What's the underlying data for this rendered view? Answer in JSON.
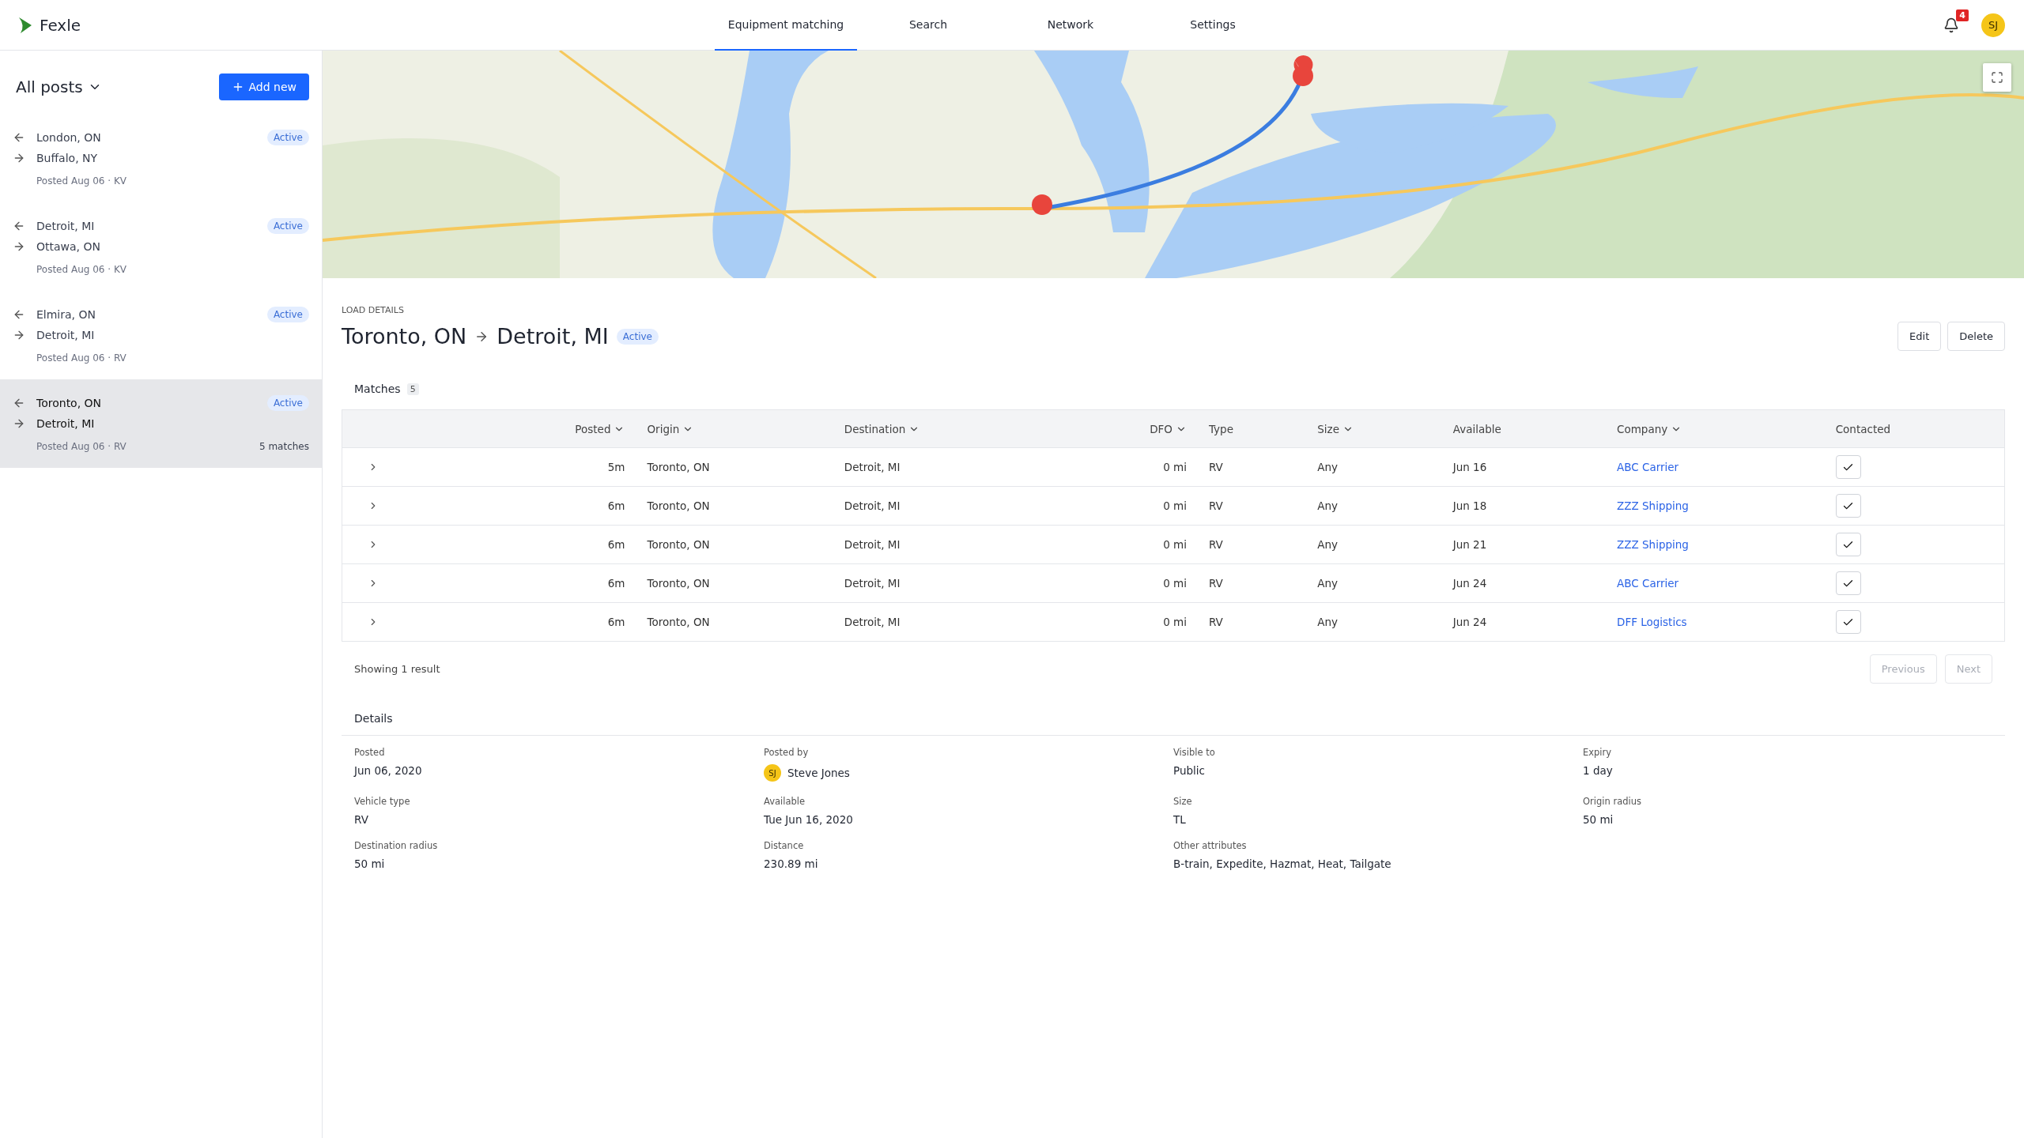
{
  "header": {
    "logo": "Fexle",
    "nav": [
      {
        "label": "Equipment matching",
        "selected": true
      },
      {
        "label": "Search",
        "selected": false
      },
      {
        "label": "Network",
        "selected": false
      },
      {
        "label": "Settings",
        "selected": false
      }
    ],
    "notifications": "4",
    "avatar": "SJ"
  },
  "sidebar": {
    "filter": "All posts",
    "add_button": "Add new",
    "posts": [
      {
        "origin": "London, ON",
        "destination": "Buffalo, NY",
        "meta": "Posted Aug 06 · KV",
        "status": "Active",
        "selected": false
      },
      {
        "origin": "Detroit, MI",
        "destination": "Ottawa, ON",
        "meta": "Posted Aug 06 · KV",
        "status": "Active",
        "selected": false
      },
      {
        "origin": "Elmira, ON",
        "destination": "Detroit, MI",
        "meta": "Posted Aug 06 · RV",
        "status": "Active",
        "selected": false
      },
      {
        "origin": "Toronto, ON",
        "destination": "Detroit, MI",
        "meta": "Posted Aug 06 · RV",
        "status": "Active",
        "selected": true,
        "matches": "5 matches"
      }
    ]
  },
  "load": {
    "eyebrow": "LOAD DETAILS",
    "origin": "Toronto, ON",
    "destination": "Detroit, MI",
    "status": "Active",
    "actions": [
      "Edit",
      "Delete"
    ]
  },
  "matches": {
    "title": "Matches",
    "count": "5",
    "columns": [
      {
        "label": "Posted",
        "sortable": true
      },
      {
        "label": "Origin",
        "sortable": true
      },
      {
        "label": "Destination",
        "sortable": true
      },
      {
        "label": "DFO",
        "sortable": true
      },
      {
        "label": "Type",
        "sortable": false
      },
      {
        "label": "Size",
        "sortable": true
      },
      {
        "label": "Available",
        "sortable": false
      },
      {
        "label": "Company",
        "sortable": true
      },
      {
        "label": "Contacted",
        "sortable": false
      }
    ],
    "rows": [
      {
        "cells": [
          "5m",
          "Toronto, ON",
          "Detroit, MI",
          "0 mi",
          "RV",
          "Any",
          "Jun 16",
          "ABC Carrier"
        ],
        "contacted": true
      },
      {
        "cells": [
          "6m",
          "Toronto, ON",
          "Detroit, MI",
          "0 mi",
          "RV",
          "Any",
          "Jun 18",
          "ZZZ Shipping"
        ],
        "contacted": true
      },
      {
        "cells": [
          "6m",
          "Toronto, ON",
          "Detroit, MI",
          "0 mi",
          "RV",
          "Any",
          "Jun 21",
          "ZZZ Shipping"
        ],
        "contacted": true
      },
      {
        "cells": [
          "6m",
          "Toronto, ON",
          "Detroit, MI",
          "0 mi",
          "RV",
          "Any",
          "Jun 24",
          "ABC Carrier"
        ],
        "contacted": true
      },
      {
        "cells": [
          "6m",
          "Toronto, ON",
          "Detroit, MI",
          "0 mi",
          "RV",
          "Any",
          "Jun 24",
          "DFF Logistics"
        ],
        "contacted": true
      }
    ],
    "summary": "Showing 1 result",
    "pagination": [
      {
        "label": "Previous",
        "disabled": true
      },
      {
        "label": "Next",
        "disabled": true
      }
    ]
  },
  "details": {
    "title": "Details",
    "fields": [
      {
        "label": "Posted",
        "value": "Jun 06, 2020"
      },
      {
        "label": "Posted by",
        "value": "Steve Jones",
        "avatar": "SJ"
      },
      {
        "label": "Visible to",
        "value": "Public"
      },
      {
        "label": "Expiry",
        "value": "1 day"
      },
      {
        "label": "Vehicle type",
        "value": "RV"
      },
      {
        "label": "Available",
        "value": "Tue Jun 16, 2020"
      },
      {
        "label": "Size",
        "value": "TL"
      },
      {
        "label": "Origin radius",
        "value": "50 mi"
      },
      {
        "label": "Destination radius",
        "value": "50 mi"
      },
      {
        "label": "Distance",
        "value": "230.89 mi"
      },
      {
        "label": "Other attributes",
        "value": "B-train, Expedite, Hazmat, Heat, Tailgate"
      }
    ]
  }
}
